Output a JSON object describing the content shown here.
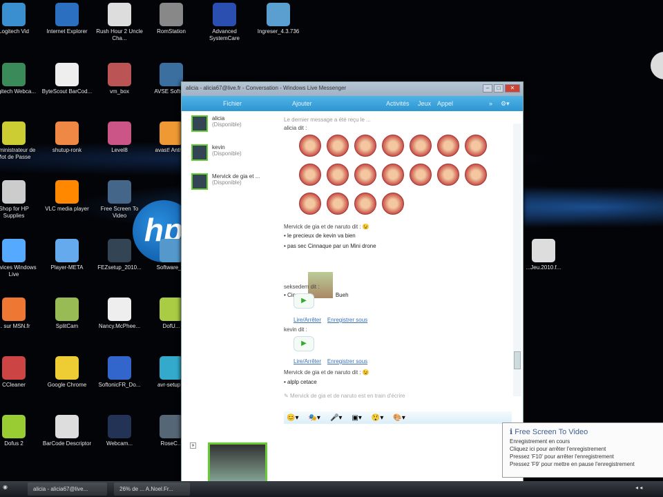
{
  "desktop": {
    "icons": [
      "Logitech Vid",
      "Internet Explorer",
      "Rush Hour 2 Uncle Cha...",
      "RomStation",
      "Advanced SystemCare",
      "Ingreser_4.3.736",
      "Logitech Webca...",
      "ByteScout BarCod...",
      "vm_box",
      "AVSE Softw...",
      "Administrateur de Mot de Passe",
      "shutup-ronk",
      "Level8",
      "avast! Antiv...",
      "Shop for HP Supplies",
      "VLC media player",
      "Free Screen To Video",
      "Services Windows Live",
      "Player-META",
      "FEZsetup_2010...",
      "Software_...",
      "... sur MSN.fr",
      "SplitCam",
      "Nancy.McPhee...",
      "DofU...",
      "CCleaner",
      "Google Chrome",
      "SoftonicFR_Do...",
      "avr-setup...",
      "Dofus 2",
      "BarCode Descriptor",
      "Webcam...",
      "RoseC...",
      "...Jeu.2010.f..."
    ],
    "logo": "hp"
  },
  "messenger": {
    "title": "alicia - alicia67@live.fr - Conversation - Windows Live Messenger",
    "toolbar": [
      "Fichier",
      "Ajouter",
      "Activités",
      "Jeux",
      "Appel"
    ],
    "contacts": [
      {
        "name": "alicia",
        "status": "(Disponible)"
      },
      {
        "name": "kevin",
        "status": "(Disponible)"
      },
      {
        "name": "Mervick de gia et ...",
        "status": "(Disponible)"
      }
    ],
    "chat": {
      "top_line": "Le dernier message a été reçu le ...",
      "sender1": "alicia dit :",
      "emoticon_count": 18,
      "sender2": "Mervick de gia et de naruto dit :",
      "msg1": "le precieux de kevin va bien",
      "msg2": "pas sec Cinnaque par un Mini drone",
      "msg3a": "Cinnar",
      "msg3b": "Bueh",
      "sender3": "seksedem dit :",
      "listen": "Lire/Arrêter",
      "save": "Enregistrer sous",
      "sender4": "kevin dit :",
      "listen2": "Lire/Arrêter",
      "save2": "Enregistrer sous",
      "sender5": "Mervick de gia et de naruto dit :",
      "msg4": "alplp cetace",
      "typing": "Mervick de gia et de naruto est en train d'écrire"
    }
  },
  "notification": {
    "title": "Free Screen To Video",
    "lines": [
      "Enregistrement en cours",
      "Cliquez ici pour arrêter l'enregistrement",
      "Pressez 'F10' pour arrêter l'enregistrement",
      "Pressez 'F9' pour mettre en pause l'enregistrement"
    ]
  },
  "taskbar": {
    "items": [
      "alicia - alicia67@live...",
      "26% de ... A.Noel.Fr..."
    ]
  },
  "colors": {
    "toolbar": "#3aa0d8",
    "avatar_border": "#66cc33",
    "link": "#3a6fb5"
  }
}
